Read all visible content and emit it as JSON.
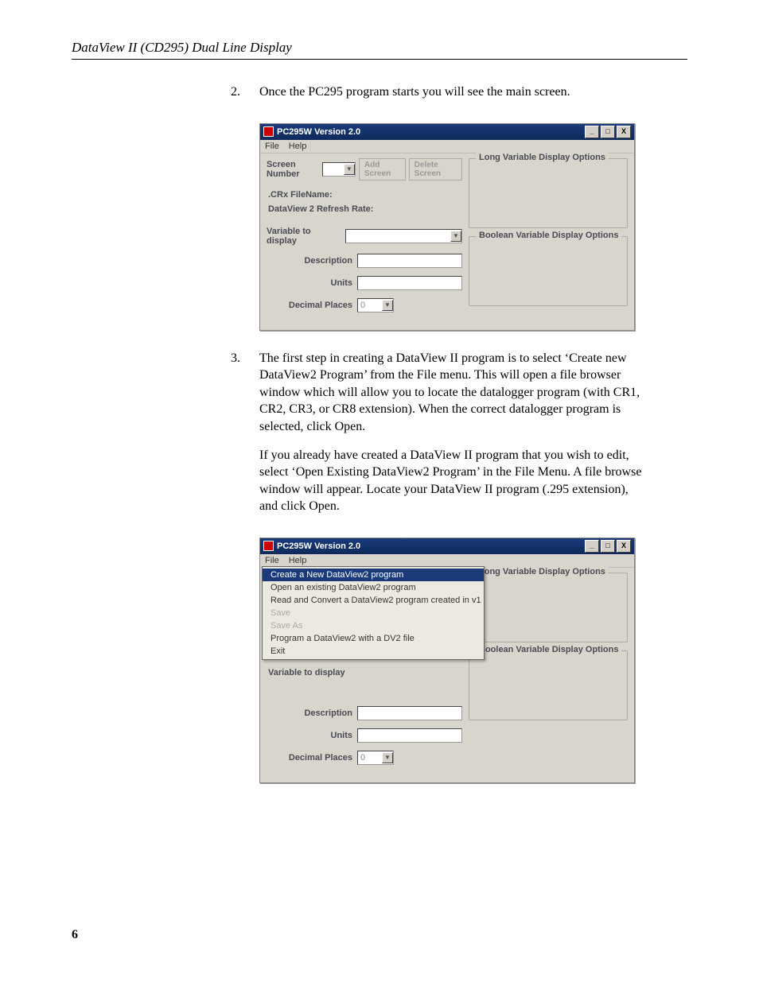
{
  "header": {
    "running_head": "DataView II (CD295) Dual Line Display"
  },
  "steps": {
    "s2_num": "2.",
    "s2_text": "Once the PC295 program starts you will see the main screen.",
    "s3_num": "3.",
    "s3_p1": "The first step in creating a DataView II program is to select ‘Create new DataView2 Program’ from the File menu. This will open a file browser window which will allow you to locate the datalogger program (with CR1, CR2, CR3, or CR8 extension). When the correct datalogger program is selected, click Open.",
    "s3_p2": "If you already have created a DataView II program that you wish to edit, select ‘Open Existing DataView2 Program’ in the File Menu. A file browse window will appear. Locate your DataView II program (.295 extension), and click Open."
  },
  "win": {
    "title": "PC295W Version 2.0",
    "menu_file": "File",
    "menu_help": "Help",
    "minimize": "_",
    "maximize": "□",
    "close": "X",
    "screen_number": "Screen Number",
    "add_screen": "Add Screen",
    "delete_screen": "Delete Screen",
    "crx_filename": ".CRx FileName:",
    "refresh_rate": "DataView 2 Refresh Rate:",
    "variable_to_display": "Variable to display",
    "description": "Description",
    "units": "Units",
    "decimal_places": "Decimal Places",
    "decimal_value": "0",
    "long_var": "Long Variable Display Options",
    "bool_var": "Boolean Variable Display Options",
    "arrow": "▼"
  },
  "dropdown": {
    "i1": "Create a New DataView2 program",
    "i2": "Open an existing DataView2 program",
    "i3": "Read and Convert a DataView2 program created in v1",
    "i4": "Save",
    "i5": "Save As",
    "i6": "Program a DataView2 with a DV2 file",
    "i7": "Exit"
  },
  "page_number": "6"
}
